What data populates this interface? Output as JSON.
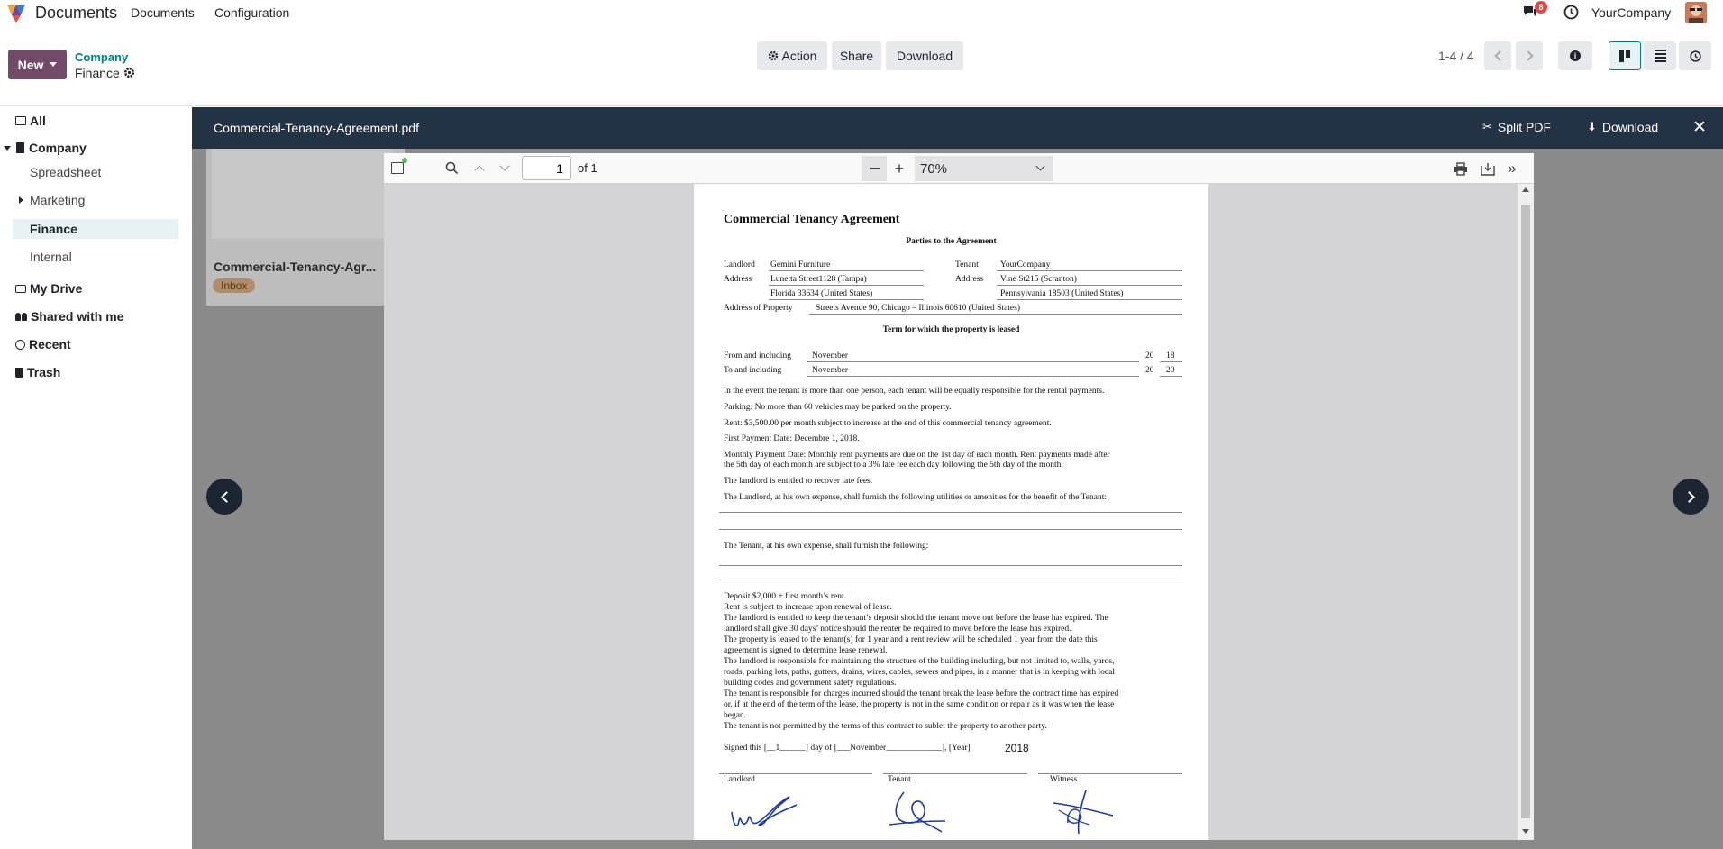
{
  "app": {
    "name": "Documents"
  },
  "nav": {
    "menu1": "Documents",
    "menu2": "Configuration",
    "chat_count": "8",
    "company": "YourCompany"
  },
  "control": {
    "new_label": "New",
    "breadcrumb_parent": "Company",
    "breadcrumb_current": "Finance",
    "action_label": "Action",
    "share_label": "Share",
    "download_label": "Download",
    "pager": "1-4 / 4"
  },
  "sidebar": {
    "all": "All",
    "company": "Company",
    "spreadsheet": "Spreadsheet",
    "marketing": "Marketing",
    "finance": "Finance",
    "internal": "Internal",
    "my_drive": "My Drive",
    "shared": "Shared with me",
    "recent": "Recent",
    "trash": "Trash"
  },
  "card": {
    "title": "Commercial-Tenancy-Agr...",
    "tag": "Inbox"
  },
  "viewer": {
    "filename": "Commercial-Tenancy-Agreement.pdf",
    "split_label": "Split PDF",
    "download_label": "Download"
  },
  "pdf": {
    "page_value": "1",
    "page_of": "of 1",
    "zoom": "70%"
  },
  "doc": {
    "title": "Commercial Tenancy Agreement",
    "parties_heading": "Parties to the Agreement",
    "landlord_label": "Landlord",
    "landlord_value": "Gemini Furniture",
    "tenant_label": "Tenant",
    "tenant_value": "YourCompany",
    "address_label": "Address",
    "landlord_addr1": "Lunetta Street1128 (Tampa)",
    "landlord_addr2": "Florida 33634 (United States)",
    "tenant_addr1": "Vine St215 (Scranton)",
    "tenant_addr2": "Pennsylvania 18503 (United States)",
    "property_label": "Address of Property",
    "property_value": "Streets Avenue 90, Chicago – Illinois 60610  (United States)",
    "term_heading": "Term for which the property is leased",
    "from_label": "From and including",
    "from_value": "November",
    "to_label": "To and including",
    "to_value": "November",
    "century": "20",
    "from_year": "18",
    "to_year": "20",
    "l1": "In the event the tenant is more than one person, each tenant will be equally responsible for the rental payments.",
    "l2": "Parking: No more than 60 vehicles may be parked on the property.",
    "l3": "Rent: $3,500.00 per month subject to increase at the end of this commercial tenancy agreement.",
    "l4": "First Payment Date: Decembre 1, 2018.",
    "l5a": "Monthly Payment Date: Monthly rent payments are due on the 1st day of each month. Rent payments made after",
    "l5b": "the 5th day of each month are subject to a 3% late fee each day following the 5th day of the month.",
    "l6": "The landlord is entitled to recover late fees.",
    "l7": "The Landlord, at his own expense, shall furnish the following utilities or amenities for the benefit of the Tenant:",
    "l8": "The Tenant, at his own expense, shall furnish the following:",
    "t1": "Deposit $2,000 + first month’s rent.",
    "t2": "Rent is subject to increase upon renewal of lease.",
    "t3": "The landlord is entitled to keep the tenant’s deposit should the tenant move out before the lease has expired. The",
    "t4": "landlord shall give 30 days’ notice should the renter be required to move before the lease has expired.",
    "t5": "The property is leased to the tenant(s) for 1 year and a rent review will be scheduled 1 year from the date this",
    "t6": "agreement is signed to determine lease renewal.",
    "t7": "The landlord is responsible for maintaining the structure of the building including, but not limited to, walls, yards,",
    "t8": "roads, parking lots, paths, gutters, drains, wires, cables, sewers and pipes, in a manner that is in keeping with local",
    "t9": "building codes and government safety regulations.",
    "t10": "The tenant is responsible for charges incurred should the tenant break the lease before the contract time has expired",
    "t11": "or, if at the end of the term of the lease, the property is not in the same condition or repair as it was when the lease",
    "t12": "began.",
    "t13": "The tenant is not permitted by the terms of this contract to sublet the property to another party.",
    "signed": "Signed this [__1______] day of [___November_____________], [Year]",
    "signed_year": "2018",
    "sig_landlord": "Landlord",
    "sig_tenant": "Tenant",
    "sig_witness": "Witness"
  }
}
